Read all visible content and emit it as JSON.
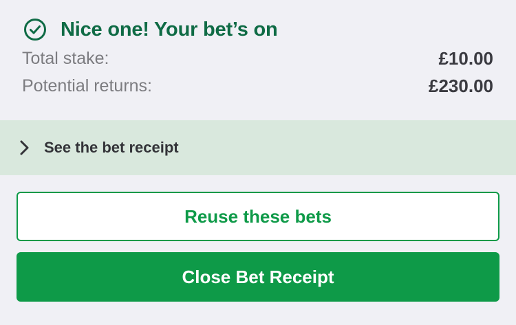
{
  "confirmation": {
    "title": "Nice one! Your bet’s on",
    "icon": "check-circle-icon"
  },
  "summary": {
    "total_stake_label": "Total stake:",
    "total_stake_value": "£10.00",
    "potential_returns_label": "Potential returns:",
    "potential_returns_value": "£230.00"
  },
  "receipt": {
    "label": "See the bet receipt",
    "icon": "chevron-right-icon"
  },
  "actions": {
    "reuse_label": "Reuse these bets",
    "close_label": "Close Bet Receipt"
  },
  "colors": {
    "title_green": "#0f6b45",
    "brand_green": "#0e9a48",
    "receipt_bar_bg": "#d9e8dd",
    "page_bg": "#f0f0f5"
  }
}
